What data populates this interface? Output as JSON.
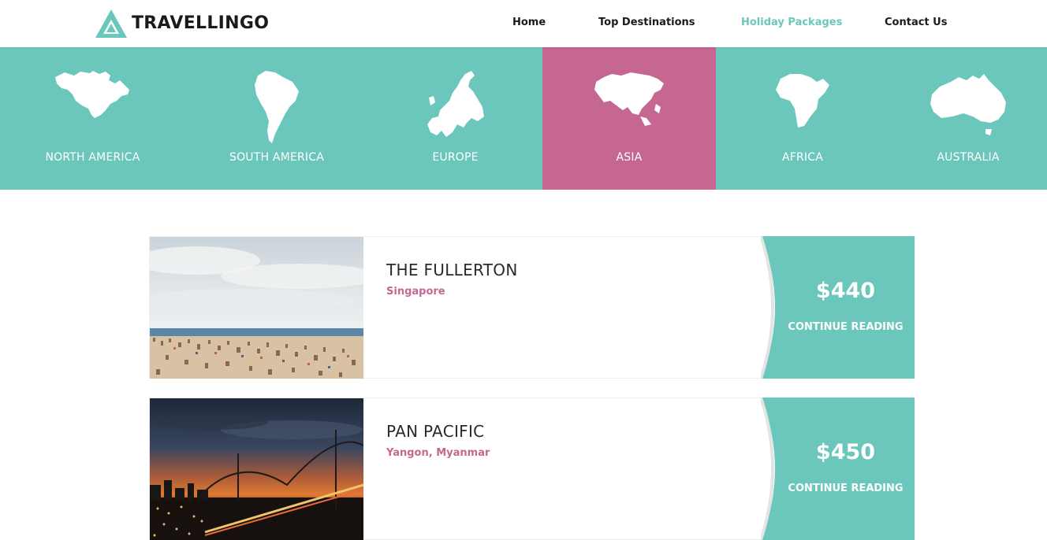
{
  "header": {
    "brand": "TRAVELLINGO",
    "nav": [
      {
        "label": "Home"
      },
      {
        "label": "Top Destinations"
      },
      {
        "label": "Holiday Packages"
      },
      {
        "label": "Contact Us"
      }
    ],
    "active_nav": "Holiday Packages"
  },
  "continents": [
    {
      "label": "NORTH AMERICA",
      "icon": "north-america-map-icon"
    },
    {
      "label": "SOUTH AMERICA",
      "icon": "south-america-map-icon"
    },
    {
      "label": "EUROPE",
      "icon": "europe-map-icon"
    },
    {
      "label": "ASIA",
      "icon": "asia-map-icon"
    },
    {
      "label": "AFRICA",
      "icon": "africa-map-icon"
    },
    {
      "label": "AUSTRALIA",
      "icon": "australia-map-icon"
    }
  ],
  "active_continent": "ASIA",
  "packages": [
    {
      "title": "THE FULLERTON",
      "location": "Singapore",
      "price": "$440",
      "cta": "CONTINUE READING",
      "image": "beach-photo"
    },
    {
      "title": "PAN PACIFIC",
      "location": "Yangon, Myanmar",
      "price": "$450",
      "cta": "CONTINUE READING",
      "image": "city-bridge-night-photo"
    }
  ],
  "colors": {
    "accent_teal": "#6bc7bb",
    "accent_pink": "#c56791",
    "text_dark": "#1a1a1a"
  }
}
